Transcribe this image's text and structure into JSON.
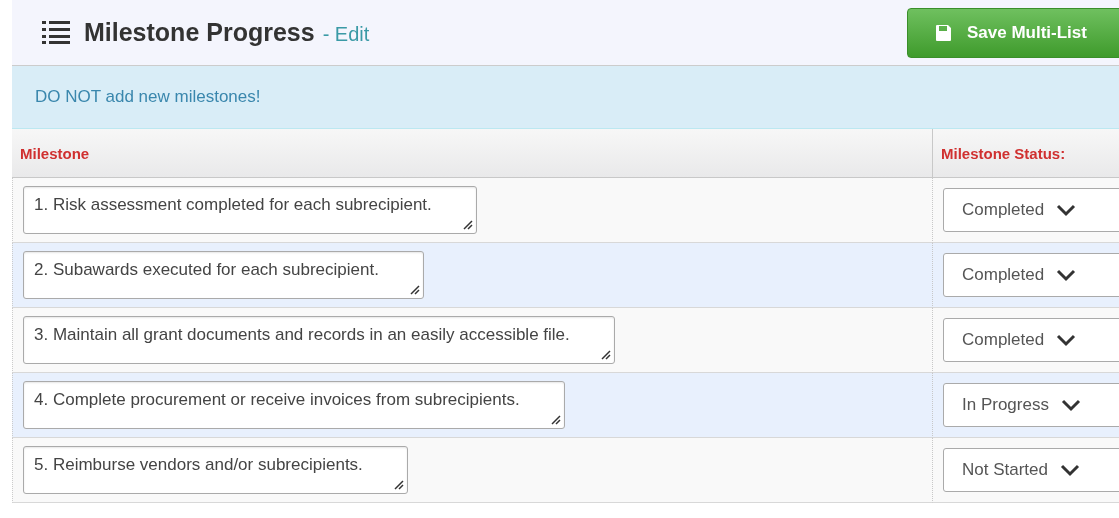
{
  "header": {
    "title": "Milestone Progress",
    "edit_link": "- Edit",
    "save_button": "Save Multi-List"
  },
  "alert": "DO NOT add new milestones!",
  "table": {
    "columns": [
      "Milestone",
      "Milestone Status:"
    ],
    "rows": [
      {
        "milestone": "1. Risk assessment completed for each subrecipient.",
        "status": "Completed"
      },
      {
        "milestone": "2. Subawards executed for each subrecipient.",
        "status": "Completed"
      },
      {
        "milestone": "3. Maintain all grant documents and records in an easily accessible file.",
        "status": "Completed"
      },
      {
        "milestone": "4. Complete procurement or receive invoices from subrecipients.",
        "status": "In Progress"
      },
      {
        "milestone": "5. Reimburse vendors and/or subrecipients.",
        "status": "Not Started"
      }
    ]
  }
}
